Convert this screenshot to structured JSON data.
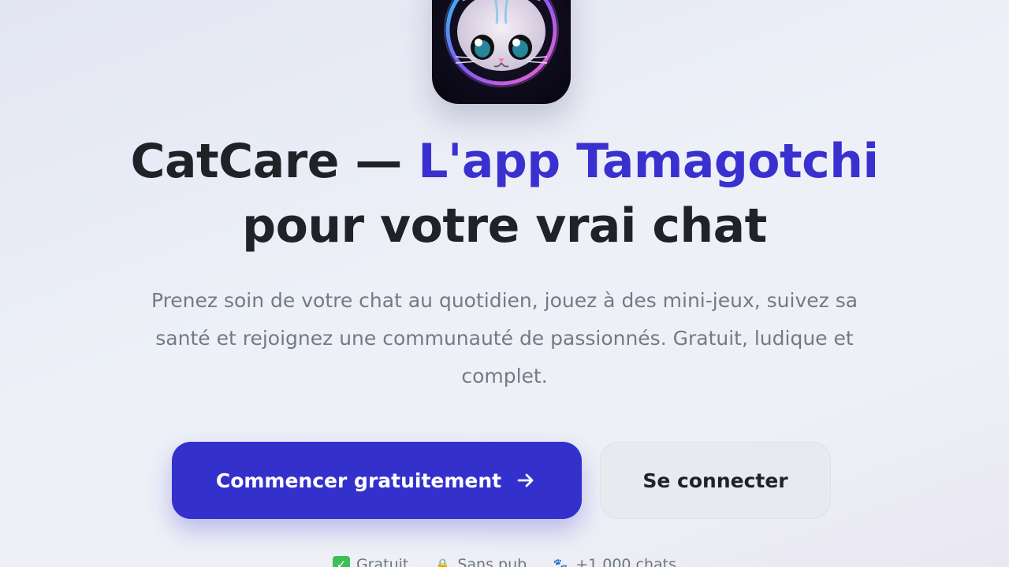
{
  "hero": {
    "app_icon_name": "catcare-app-icon",
    "title_part1": "CatCare — ",
    "title_accent": "L'app Tamagotchi",
    "title_part2": "pour votre vrai chat",
    "subtitle": "Prenez soin de votre chat au quotidien, jouez à des mini-jeux, suivez sa santé et rejoignez une communauté de passionnés. Gratuit, ludique et complet."
  },
  "actions": {
    "primary_label": "Commencer gratuitement",
    "primary_icon": "arrow-right-icon",
    "secondary_label": "Se connecter"
  },
  "perks": [
    {
      "icon": "check-icon",
      "glyph": "✓",
      "label": "Gratuit"
    },
    {
      "icon": "lock-icon",
      "glyph": "🔒",
      "label": "Sans pub"
    },
    {
      "icon": "paw-icon",
      "glyph": "🐾",
      "label": "+1 000 chats"
    }
  ],
  "colors": {
    "accent": "#3a30cf",
    "primary_button": "#3430cc",
    "secondary_button": "#e7eaef",
    "text": "#1f2328",
    "muted_text": "#737a86"
  }
}
